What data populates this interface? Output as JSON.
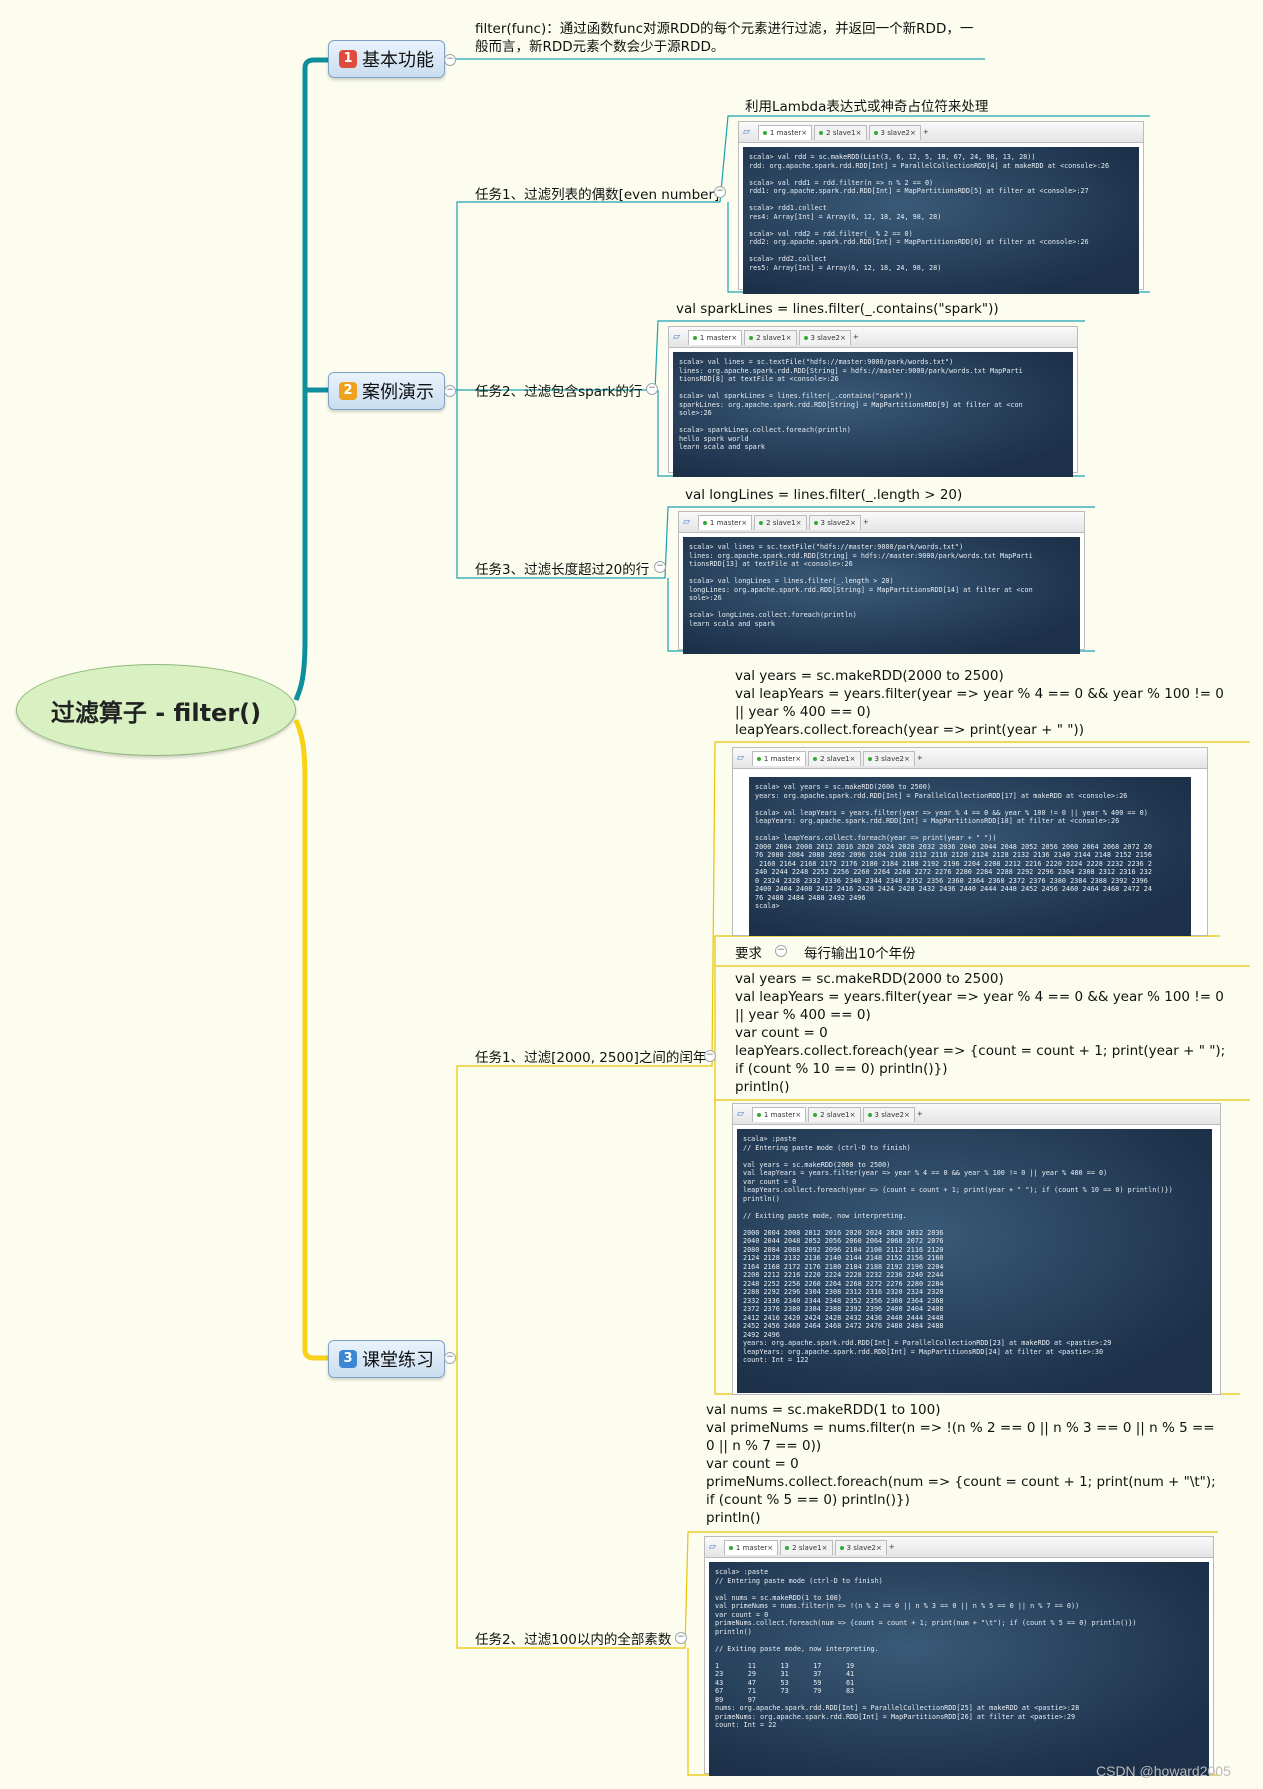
{
  "root": {
    "title": "过滤算子 - filter()"
  },
  "branches": [
    {
      "num": "1",
      "label": "基本功能",
      "badge_color": "#E04A3C"
    },
    {
      "num": "2",
      "label": "案例演示",
      "badge_color": "#F0A21E"
    },
    {
      "num": "3",
      "label": "课堂练习",
      "badge_color": "#3D86D6"
    }
  ],
  "basic": {
    "desc": "filter(func)：通过函数func对源RDD的每个元素进行过滤，并返回一个新RDD，一般而言，新RDD元素个数会少于源RDD。"
  },
  "demo": {
    "task1": {
      "label": "任务1、过滤列表的偶数[even number]",
      "note": "利用Lambda表达式或神奇占位符来处理"
    },
    "task2": {
      "label": "任务2、过滤包含spark的行",
      "note": "val sparkLines = lines.filter(_.contains(\"spark\"))"
    },
    "task3": {
      "label": "任务3、过滤长度超过20的行",
      "note": "val longLines = lines.filter(_.length > 20)"
    }
  },
  "practice": {
    "task1": {
      "label": "任务1、过滤[2000, 2500]之间的闰年",
      "code1": "val years = sc.makeRDD(2000 to 2500)\nval leapYears = years.filter(year => year % 4 == 0 && year % 100 != 0 || year % 400 == 0)\nleapYears.collect.foreach(year => print(year + \" \"))",
      "req_label": "要求",
      "req_value": "每行输出10个年份",
      "code2": "val years = sc.makeRDD(2000 to 2500)\nval leapYears = years.filter(year => year % 4 == 0 && year % 100 != 0 || year % 400 == 0)\nvar count = 0\nleapYears.collect.foreach(year => {count = count + 1; print(year + \" \"); if (count % 10 == 0) println()})\nprintln()"
    },
    "task2": {
      "label": "任务2、过滤100以内的全部素数",
      "code": "val nums = sc.makeRDD(1 to 100)\nval primeNums = nums.filter(n => !(n % 2 == 0 || n % 3 == 0 || n % 5 == 0 || n % 7 == 0))\nvar count = 0\nprimeNums.collect.foreach(num => {count = count + 1; print(num + \"\\t\"); if (count % 5 == 0) println()})\nprintln()"
    }
  },
  "terminal": {
    "tabs": [
      "1 master",
      "2 slave1",
      "3 slave2"
    ],
    "plus": "+"
  },
  "consoles": {
    "c1": "scala> val rdd = sc.makeRDD(List(3, 6, 12, 5, 18, 67, 24, 98, 13, 28))\nrdd: org.apache.spark.rdd.RDD[Int] = ParallelCollectionRDD[4] at makeRDD at <console>:26\n\nscala> val rdd1 = rdd.filter(n => n % 2 == 0)\nrdd1: org.apache.spark.rdd.RDD[Int] = MapPartitionsRDD[5] at filter at <console>:27\n\nscala> rdd1.collect\nres4: Array[Int] = Array(6, 12, 18, 24, 98, 28)\n\nscala> val rdd2 = rdd.filter(_ % 2 == 0)\nrdd2: org.apache.spark.rdd.RDD[Int] = MapPartitionsRDD[6] at filter at <console>:26\n\nscala> rdd2.collect\nres5: Array[Int] = Array(6, 12, 18, 24, 98, 28)",
    "c2": "scala> val lines = sc.textFile(\"hdfs://master:9000/park/words.txt\")\nlines: org.apache.spark.rdd.RDD[String] = hdfs://master:9000/park/words.txt MapParti\ntionsRDD[8] at textFile at <console>:26\n\nscala> val sparkLines = lines.filter(_.contains(\"spark\"))\nsparkLines: org.apache.spark.rdd.RDD[String] = MapPartitionsRDD[9] at filter at <con\nsole>:26\n\nscala> sparkLines.collect.foreach(println)\nhello spark world\nlearn scala and spark",
    "c3": "scala> val lines = sc.textFile(\"hdfs://master:9000/park/words.txt\")\nlines: org.apache.spark.rdd.RDD[String] = hdfs://master:9000/park/words.txt MapParti\ntionsRDD[13] at textFile at <console>:26\n\nscala> val longLines = lines.filter(_.length > 20)\nlongLines: org.apache.spark.rdd.RDD[String] = MapPartitionsRDD[14] at filter at <con\nsole>:26\n\nscala> longLines.collect.foreach(println)\nlearn scala and spark",
    "c4": "scala> val years = sc.makeRDD(2000 to 2500)\nyears: org.apache.spark.rdd.RDD[Int] = ParallelCollectionRDD[17] at makeRDD at <console>:26\n\nscala> val leapYears = years.filter(year => year % 4 == 0 && year % 100 != 0 || year % 400 == 0)\nleapYears: org.apache.spark.rdd.RDD[Int] = MapPartitionsRDD[18] at filter at <console>:26\n\nscala> leapYears.collect.foreach(year => print(year + \" \"))\n2000 2004 2008 2012 2016 2020 2024 2028 2032 2036 2040 2044 2048 2052 2056 2060 2064 2068 2072 20\n76 2080 2084 2088 2092 2096 2104 2108 2112 2116 2120 2124 2128 2132 2136 2140 2144 2148 2152 2156\n 2160 2164 2168 2172 2176 2180 2184 2188 2192 2196 2204 2208 2212 2216 2220 2224 2228 2232 2236 2\n240 2244 2248 2252 2256 2260 2264 2268 2272 2276 2280 2284 2288 2292 2296 2304 2308 2312 2316 232\n0 2324 2328 2332 2336 2340 2344 2348 2352 2356 2360 2364 2368 2372 2376 2380 2384 2388 2392 2396\n2400 2404 2408 2412 2416 2420 2424 2428 2432 2436 2440 2444 2448 2452 2456 2460 2464 2468 2472 24\n76 2480 2484 2488 2492 2496\nscala>",
    "c5": "scala> :paste\n// Entering paste mode (ctrl-D to finish)\n\nval years = sc.makeRDD(2000 to 2500)\nval leapYears = years.filter(year => year % 4 == 0 && year % 100 != 0 || year % 400 == 0)\nvar count = 0\nleapYears.collect.foreach(year => {count = count + 1; print(year + \" \"); if (count % 10 == 0) println()})\nprintln()\n\n// Exiting paste mode, now interpreting.\n\n2000 2004 2008 2012 2016 2020 2024 2028 2032 2036\n2040 2044 2048 2052 2056 2060 2064 2068 2072 2076\n2080 2084 2088 2092 2096 2104 2108 2112 2116 2120\n2124 2128 2132 2136 2140 2144 2148 2152 2156 2160\n2164 2168 2172 2176 2180 2184 2188 2192 2196 2204\n2208 2212 2216 2220 2224 2228 2232 2236 2240 2244\n2248 2252 2256 2260 2264 2268 2272 2276 2280 2284\n2288 2292 2296 2304 2308 2312 2316 2320 2324 2328\n2332 2336 2340 2344 2348 2352 2356 2360 2364 2368\n2372 2376 2380 2384 2388 2392 2396 2400 2404 2408\n2412 2416 2420 2424 2428 2432 2436 2440 2444 2448\n2452 2456 2460 2464 2468 2472 2476 2480 2484 2488\n2492 2496\nyears: org.apache.spark.rdd.RDD[Int] = ParallelCollectionRDD[23] at makeRDD at <pastie>:29\nleapYears: org.apache.spark.rdd.RDD[Int] = MapPartitionsRDD[24] at filter at <pastie>:30\ncount: Int = 122",
    "c6": "scala> :paste\n// Entering paste mode (ctrl-D to finish)\n\nval nums = sc.makeRDD(1 to 100)\nval primeNums = nums.filter(n => !(n % 2 == 0 || n % 3 == 0 || n % 5 == 0 || n % 7 == 0))\nvar count = 0\nprimeNums.collect.foreach(num => {count = count + 1; print(num + \"\\t\"); if (count % 5 == 0) println()})\nprintln()\n\n// Exiting paste mode, now interpreting.\n\n1       11      13      17      19\n23      29      31      37      41\n43      47      53      59      61\n67      71      73      79      83\n89      97\nnums: org.apache.spark.rdd.RDD[Int] = ParallelCollectionRDD[25] at makeRDD at <pastie>:28\nprimeNums: org.apache.spark.rdd.RDD[Int] = MapPartitionsRDD[26] at filter at <pastie>:29\ncount: Int = 22"
  },
  "watermark": "CSDN @howard2005"
}
